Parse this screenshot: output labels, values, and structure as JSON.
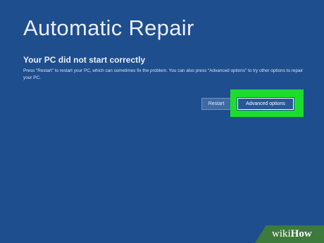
{
  "screen": {
    "title": "Automatic Repair",
    "subtitle": "Your PC did not start correctly",
    "description": "Press “Restart” to restart your PC, which can sometimes fix the problem. You can also press “Advanced options” to try other options to repair your PC."
  },
  "buttons": {
    "restart_label": "Restart",
    "advanced_label": "Advanced options"
  },
  "watermark": {
    "part1": "wiki",
    "part2": "How"
  },
  "colors": {
    "background": "#1f4e8e",
    "highlight": "#1ddd2c",
    "watermark_band": "#3d7a3b"
  }
}
